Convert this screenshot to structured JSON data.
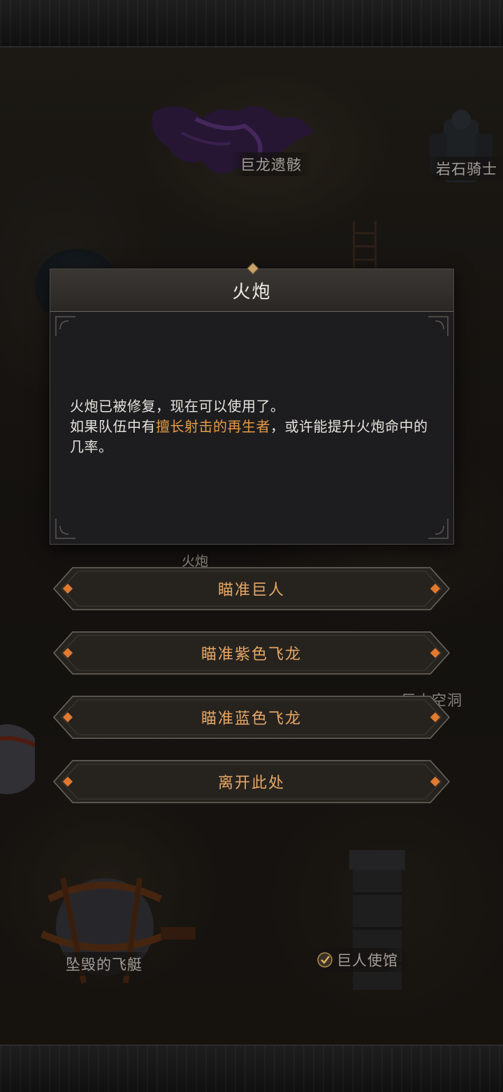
{
  "dialog": {
    "title": "火炮",
    "body_line1": "火炮已被修复，现在可以使用了。",
    "body_line2_prefix": "如果队伍中有",
    "body_highlight": "擅长射击的再生者",
    "body_line2_suffix": "，或许能提升火炮命中的几率。"
  },
  "choices": [
    {
      "label": "瞄准巨人"
    },
    {
      "label": "瞄准紫色飞龙"
    },
    {
      "label": "瞄准蓝色飞龙"
    },
    {
      "label": "离开此处"
    }
  ],
  "map_labels": {
    "dragon_remains": "巨龙遗骸",
    "rock_knight": "岩石骑士",
    "cannon": "火炮",
    "giant_cave": "巨大空洞",
    "crashed_airship": "坠毁的飞艇",
    "giant_embassy": "巨人使馆"
  },
  "colors": {
    "accent_text": "#e6a765",
    "highlight_text": "#e69a45",
    "panel_bg": "#1d1d1f"
  },
  "icons": {
    "check": "check-icon",
    "gem": "diamond-gem-icon"
  }
}
